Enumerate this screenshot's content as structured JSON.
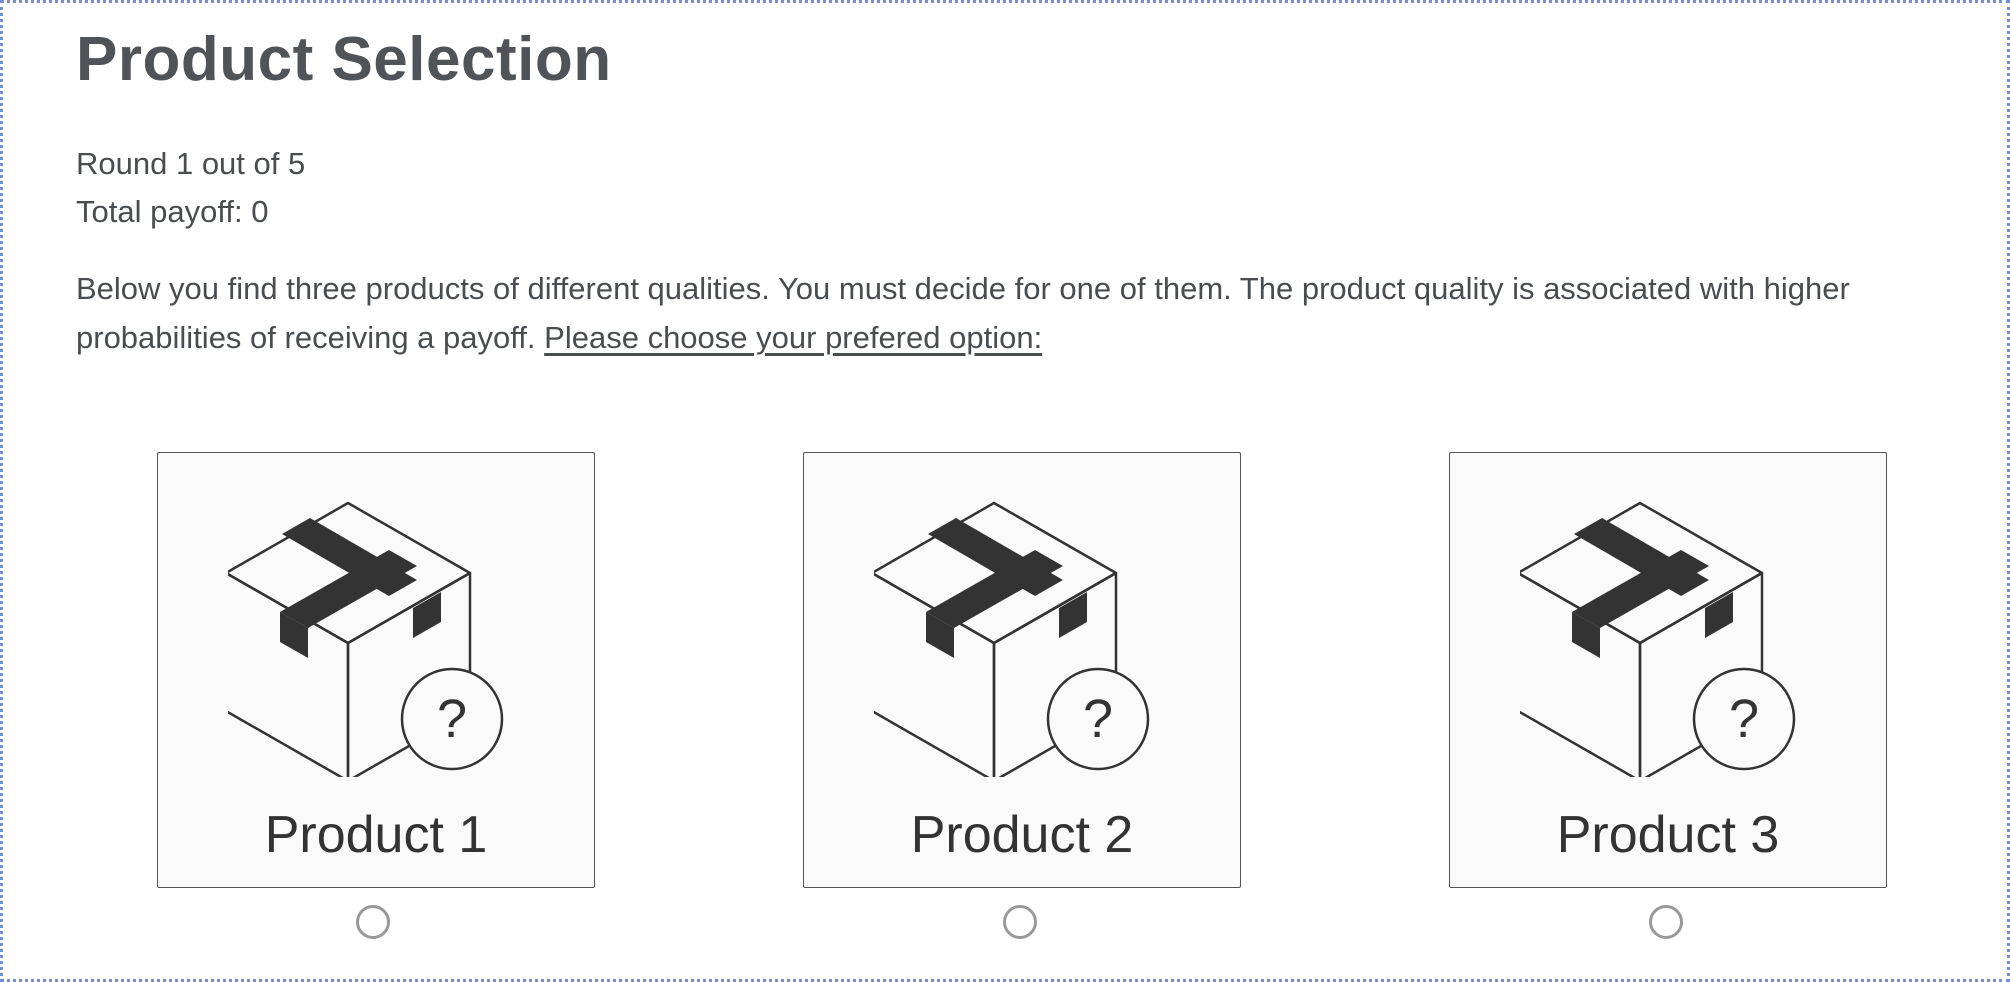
{
  "page": {
    "title": "Product Selection",
    "round_text": "Round 1 out of 5",
    "payoff_text": "Total payoff: 0",
    "intro_text": "Below you find three products of different qualities. You must decide for one of them. The product quality is associated with higher probabilities of receiving a payoff.",
    "intro_cta": "Please choose your prefered option:"
  },
  "products": [
    {
      "label": "Product 1",
      "icon": "mystery-box-icon",
      "selected": false
    },
    {
      "label": "Product 2",
      "icon": "mystery-box-icon",
      "selected": false
    },
    {
      "label": "Product 3",
      "icon": "mystery-box-icon",
      "selected": false
    }
  ],
  "colors": {
    "frame_border": "#6f8fdc",
    "card_background": "#fafafa",
    "text": "#4a4d50",
    "radio_border": "#999999"
  }
}
